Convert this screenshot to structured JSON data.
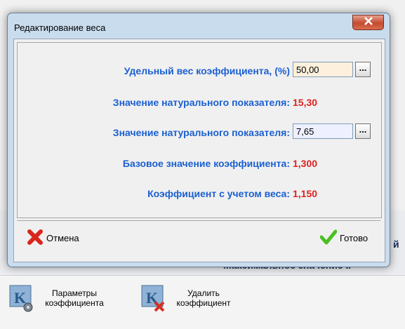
{
  "dialog": {
    "title": "Редактирование веса",
    "rows": [
      {
        "label": "Удельный вес коэффициента, (%)",
        "value": "50,00"
      },
      {
        "label": "Значение натурального показателя:",
        "value": "15,30"
      },
      {
        "label": "Значение натурального показателя:",
        "value": "7,65"
      },
      {
        "label": "Базовое значение коэффициента:",
        "value": "1,300"
      },
      {
        "label": "Коэффициент с учетом веса:",
        "value": "1,150"
      }
    ],
    "more_button_label": "...",
    "cancel_label": "Отмена",
    "ok_label": "Готово"
  },
  "background": {
    "partial_text_1": "й",
    "partial_text_2": "Максимальное значение к"
  },
  "toolbar": {
    "params_label": "Параметры коэффициента",
    "delete_label": "Удалить коэффициент"
  },
  "colors": {
    "label_blue": "#1a5fd1",
    "value_red": "#e02020",
    "field1_bg": "#fdf1dd",
    "field2_bg": "#eef0ff"
  }
}
